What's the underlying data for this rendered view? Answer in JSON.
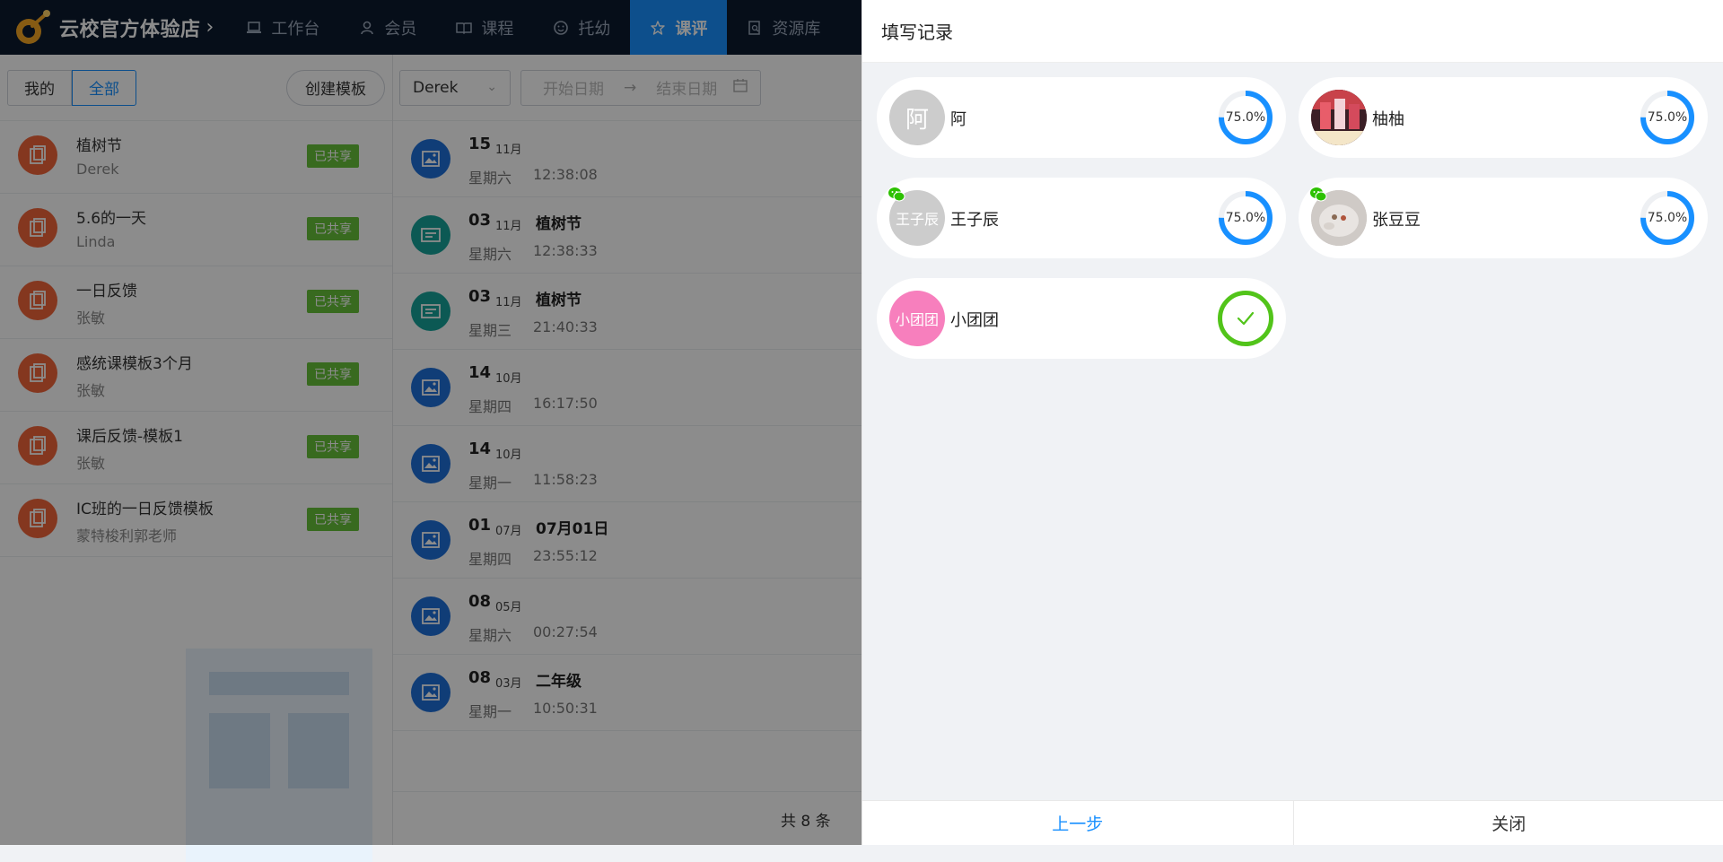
{
  "topbar": {
    "brand_title": "云校官方体验店",
    "nav": [
      {
        "label": "工作台",
        "icon": "laptop-icon"
      },
      {
        "label": "会员",
        "icon": "user-icon"
      },
      {
        "label": "课程",
        "icon": "book-icon"
      },
      {
        "label": "托幼",
        "icon": "smile-icon"
      },
      {
        "label": "课评",
        "icon": "star-icon",
        "active": true
      },
      {
        "label": "资源库",
        "icon": "document-search-icon"
      }
    ]
  },
  "templates": {
    "tabs": {
      "mine": "我的",
      "all": "全部"
    },
    "create_label": "创建模板",
    "items": [
      {
        "name": "植树节",
        "author": "Derek",
        "badge": "已共享"
      },
      {
        "name": "5.6的一天",
        "author": "Linda",
        "badge": "已共享"
      },
      {
        "name": "一日反馈",
        "author": "张敏",
        "badge": "已共享"
      },
      {
        "name": "感统课模板3个月",
        "author": "张敏",
        "badge": "已共享"
      },
      {
        "name": "课后反馈-模板1",
        "author": "张敏",
        "badge": "已共享"
      },
      {
        "name": "IC班的一日反馈模板",
        "author": "蒙特梭利郭老师",
        "badge": "已共享"
      }
    ]
  },
  "records": {
    "teacher": "Derek",
    "start_placeholder": "开始日期",
    "end_placeholder": "结束日期",
    "items": [
      {
        "day": "15",
        "month": "11月",
        "title": "",
        "weekday": "星期六",
        "time": "12:38:08",
        "icon": "image-icon"
      },
      {
        "day": "03",
        "month": "11月",
        "title": "植树节",
        "weekday": "星期六",
        "time": "12:38:33",
        "icon": "form-icon"
      },
      {
        "day": "03",
        "month": "11月",
        "title": "植树节",
        "weekday": "星期三",
        "time": "21:40:33",
        "icon": "form-icon"
      },
      {
        "day": "14",
        "month": "10月",
        "title": "",
        "weekday": "星期四",
        "time": "16:17:50",
        "icon": "image-icon"
      },
      {
        "day": "14",
        "month": "10月",
        "title": "",
        "weekday": "星期一",
        "time": "11:58:23",
        "icon": "image-icon"
      },
      {
        "day": "01",
        "month": "07月",
        "title": "07月01日",
        "weekday": "星期四",
        "time": "23:55:12",
        "icon": "image-icon"
      },
      {
        "day": "08",
        "month": "05月",
        "title": "",
        "weekday": "星期六",
        "time": "00:27:54",
        "icon": "image-icon"
      },
      {
        "day": "08",
        "month": "03月",
        "title": "二年级",
        "weekday": "星期一",
        "time": "10:50:31",
        "icon": "image-icon"
      }
    ],
    "total": "共 8 条"
  },
  "drawer": {
    "title": "填写记录",
    "students": [
      {
        "name": "阿",
        "avatar_text": "阿",
        "progress_label": "75.0%",
        "progress": 0.75,
        "wechat": false,
        "done": false
      },
      {
        "name": "柚柚",
        "avatar_text": "",
        "progress_label": "75.0%",
        "progress": 0.75,
        "wechat": false,
        "done": false
      },
      {
        "name": "王子辰",
        "avatar_text": "王子辰",
        "progress_label": "75.0%",
        "progress": 0.75,
        "wechat": true,
        "done": false
      },
      {
        "name": "张豆豆",
        "avatar_text": "",
        "progress_label": "75.0%",
        "progress": 0.75,
        "wechat": true,
        "done": false
      },
      {
        "name": "小团团",
        "avatar_text": "小团团",
        "progress_label": "",
        "progress": 1.0,
        "wechat": false,
        "done": true
      }
    ],
    "prev_label": "上一步",
    "close_label": "关闭"
  },
  "colors": {
    "accent": "#1890ff",
    "success": "#52c41a",
    "badge": "#67c23a",
    "template_icon": "#f0643a",
    "topbar": "#0b1a2f"
  }
}
